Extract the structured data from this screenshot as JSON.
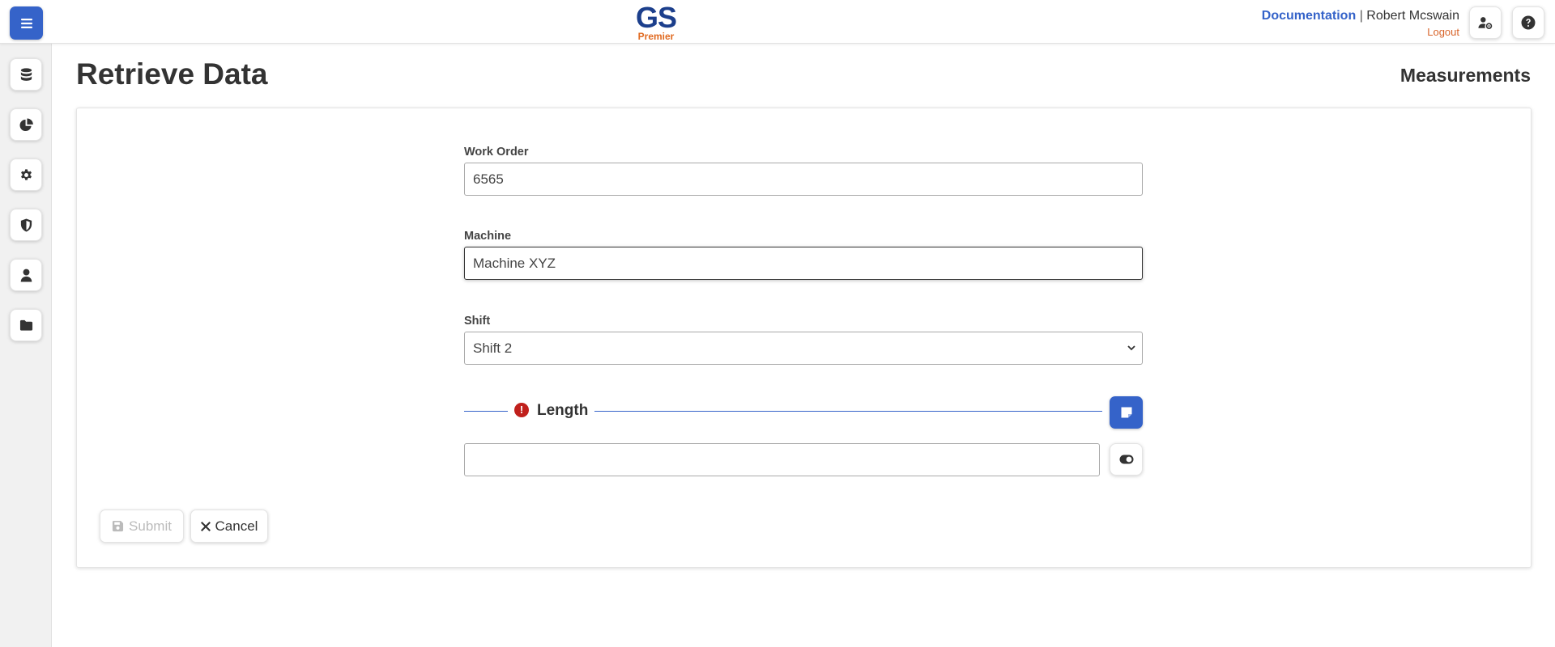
{
  "header": {
    "logo_main": "GS",
    "logo_sub": "Premier",
    "documentation_link": "Documentation",
    "separator": "|",
    "user_name": "Robert Mcswain",
    "logout_link": "Logout"
  },
  "page": {
    "title": "Retrieve Data",
    "subtitle": "Measurements"
  },
  "form": {
    "work_order": {
      "label": "Work Order",
      "value": "6565"
    },
    "machine": {
      "label": "Machine",
      "value": "Machine XYZ"
    },
    "shift": {
      "label": "Shift",
      "selected": "Shift 2"
    },
    "length": {
      "label": "Length",
      "error_symbol": "!",
      "value": ""
    }
  },
  "actions": {
    "submit_label": "Submit",
    "cancel_label": "Cancel"
  },
  "sidebar": {
    "items": [
      {
        "icon": "database-icon"
      },
      {
        "icon": "pie-chart-icon"
      },
      {
        "icon": "gear-icon"
      },
      {
        "icon": "shield-icon"
      },
      {
        "icon": "user-icon"
      },
      {
        "icon": "folder-icon"
      }
    ]
  },
  "colors": {
    "primary": "#3563c9",
    "logo_blue": "#1c3f8c",
    "logo_orange": "#e0691f",
    "logout": "#d8642a",
    "error": "#c0201c"
  }
}
